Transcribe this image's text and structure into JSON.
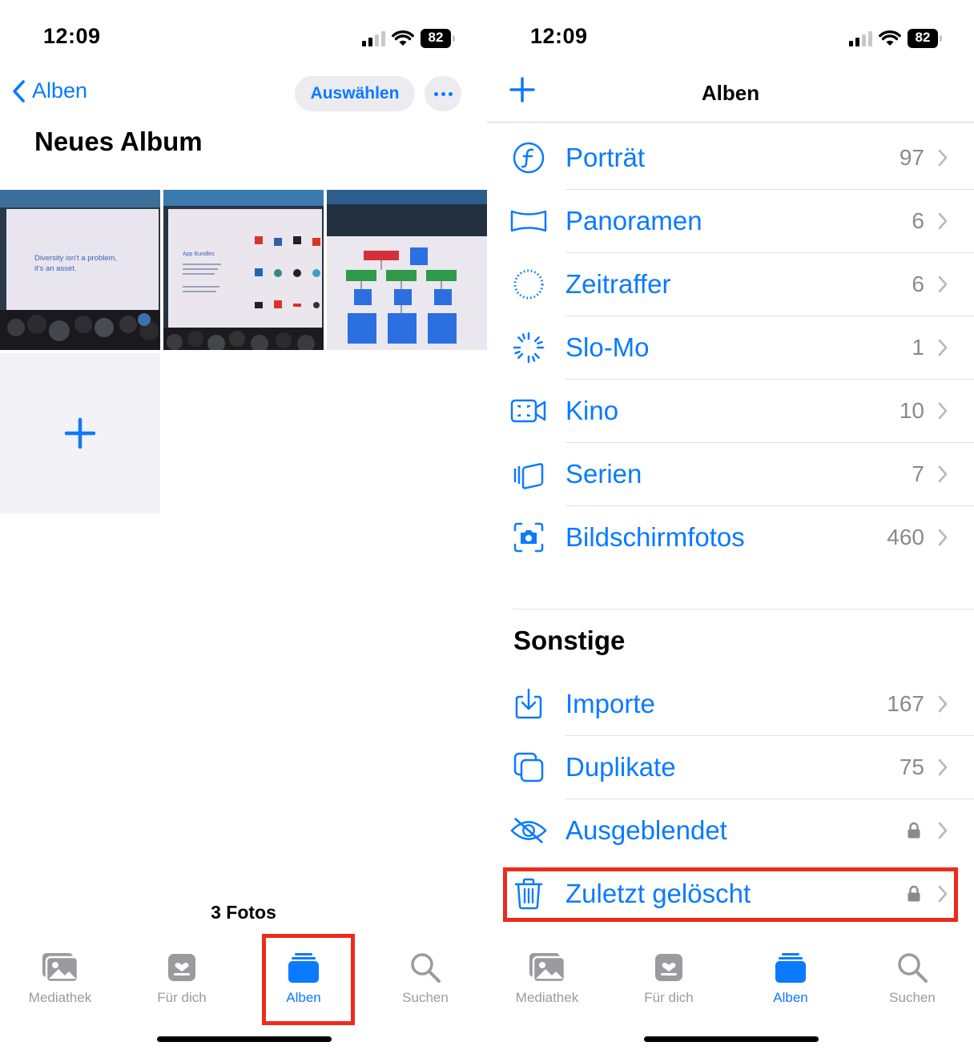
{
  "left": {
    "status": {
      "time": "12:09",
      "battery": "82"
    },
    "nav": {
      "back_label": "Alben",
      "select_label": "Auswählen"
    },
    "title": "Neues Album",
    "photos": [
      {
        "slide_text": "Diversity isn't a problem, it's an asset."
      },
      {
        "slide_text": "App Bundles"
      },
      {
        "slide_text": ""
      }
    ],
    "photo_count": "3 Fotos",
    "tabs": [
      {
        "label": "Mediathek",
        "icon": "photo-library-icon",
        "active": false
      },
      {
        "label": "Für dich",
        "icon": "for-you-icon",
        "active": false
      },
      {
        "label": "Alben",
        "icon": "albums-icon",
        "active": true
      },
      {
        "label": "Suchen",
        "icon": "search-icon",
        "active": false
      }
    ]
  },
  "right": {
    "status": {
      "time": "12:09",
      "battery": "82"
    },
    "nav": {
      "title": "Alben"
    },
    "media_types": [
      {
        "label": "Porträt",
        "count": "97",
        "icon": "portrait-icon"
      },
      {
        "label": "Panoramen",
        "count": "6",
        "icon": "panorama-icon"
      },
      {
        "label": "Zeitraffer",
        "count": "6",
        "icon": "timelapse-icon"
      },
      {
        "label": "Slo-Mo",
        "count": "1",
        "icon": "slomo-icon"
      },
      {
        "label": "Kino",
        "count": "10",
        "icon": "cinematic-icon"
      },
      {
        "label": "Serien",
        "count": "7",
        "icon": "burst-icon"
      },
      {
        "label": "Bildschirmfotos",
        "count": "460",
        "icon": "screenshot-icon"
      }
    ],
    "other_section_title": "Sonstige",
    "other": [
      {
        "label": "Importe",
        "count": "167",
        "icon": "import-icon"
      },
      {
        "label": "Duplikate",
        "count": "75",
        "icon": "duplicates-icon"
      },
      {
        "label": "Ausgeblendet",
        "locked": true,
        "icon": "hidden-icon"
      },
      {
        "label": "Zuletzt gelöscht",
        "locked": true,
        "icon": "trash-icon"
      }
    ],
    "tabs": [
      {
        "label": "Mediathek",
        "icon": "photo-library-icon",
        "active": false
      },
      {
        "label": "Für dich",
        "icon": "for-you-icon",
        "active": false
      },
      {
        "label": "Alben",
        "icon": "albums-icon",
        "active": true
      },
      {
        "label": "Suchen",
        "icon": "search-icon",
        "active": false
      }
    ]
  },
  "colors": {
    "accent": "#0a7aff",
    "highlight": "#ec2b1c",
    "inactive": "#9a9a9f"
  }
}
